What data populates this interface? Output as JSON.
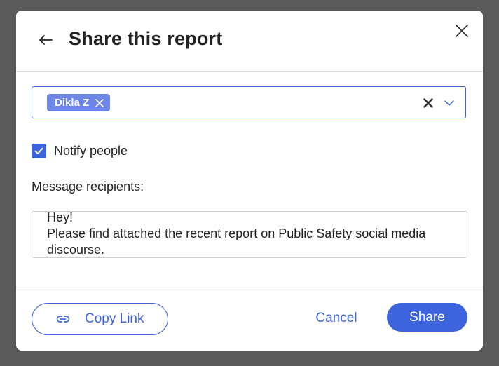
{
  "dialog": {
    "title": "Share this report",
    "back_icon": "arrow-left-icon",
    "close_icon": "close-icon"
  },
  "recipients": {
    "chips": [
      {
        "label": "Dikla Z"
      }
    ],
    "clear_icon": "clear-x-icon",
    "dropdown_icon": "chevron-down-icon"
  },
  "notify": {
    "label": "Notify people",
    "checked": true
  },
  "message": {
    "label": "Message recipients:",
    "value": "Hey!\nPlease find attached the recent report on Public Safety social media discourse."
  },
  "footer": {
    "copy_link_label": "Copy Link",
    "cancel_label": "Cancel",
    "share_label": "Share"
  },
  "colors": {
    "accent": "#3d63dd",
    "chip": "#6d86e8",
    "overlay": "#5a5a5a"
  }
}
